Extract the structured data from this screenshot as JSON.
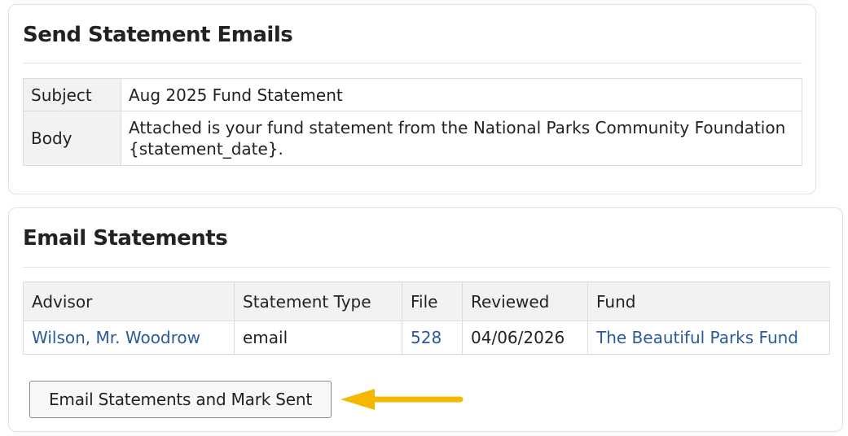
{
  "send_panel": {
    "title": "Send Statement Emails",
    "rows": [
      {
        "key": "Subject",
        "value": "Aug 2025 Fund Statement"
      },
      {
        "key": "Body",
        "value": "Attached is your fund statement from the National Parks Community Foundation {statement_date}."
      }
    ]
  },
  "email_panel": {
    "title": "Email Statements",
    "columns": [
      "Advisor",
      "Statement Type",
      "File",
      "Reviewed",
      "Fund"
    ],
    "rows": [
      {
        "advisor": "Wilson, Mr. Woodrow",
        "statement_type": "email",
        "file": "528",
        "reviewed": "04/06/2026",
        "fund": "The Beautiful Parks Fund"
      }
    ],
    "action_button_label": "Email Statements and Mark Sent"
  },
  "colors": {
    "link": "#2a5a9a",
    "arrow": "#f5b800",
    "header_bg": "#f2f2f2"
  },
  "icons": {
    "pointer": "arrow-left-icon"
  }
}
